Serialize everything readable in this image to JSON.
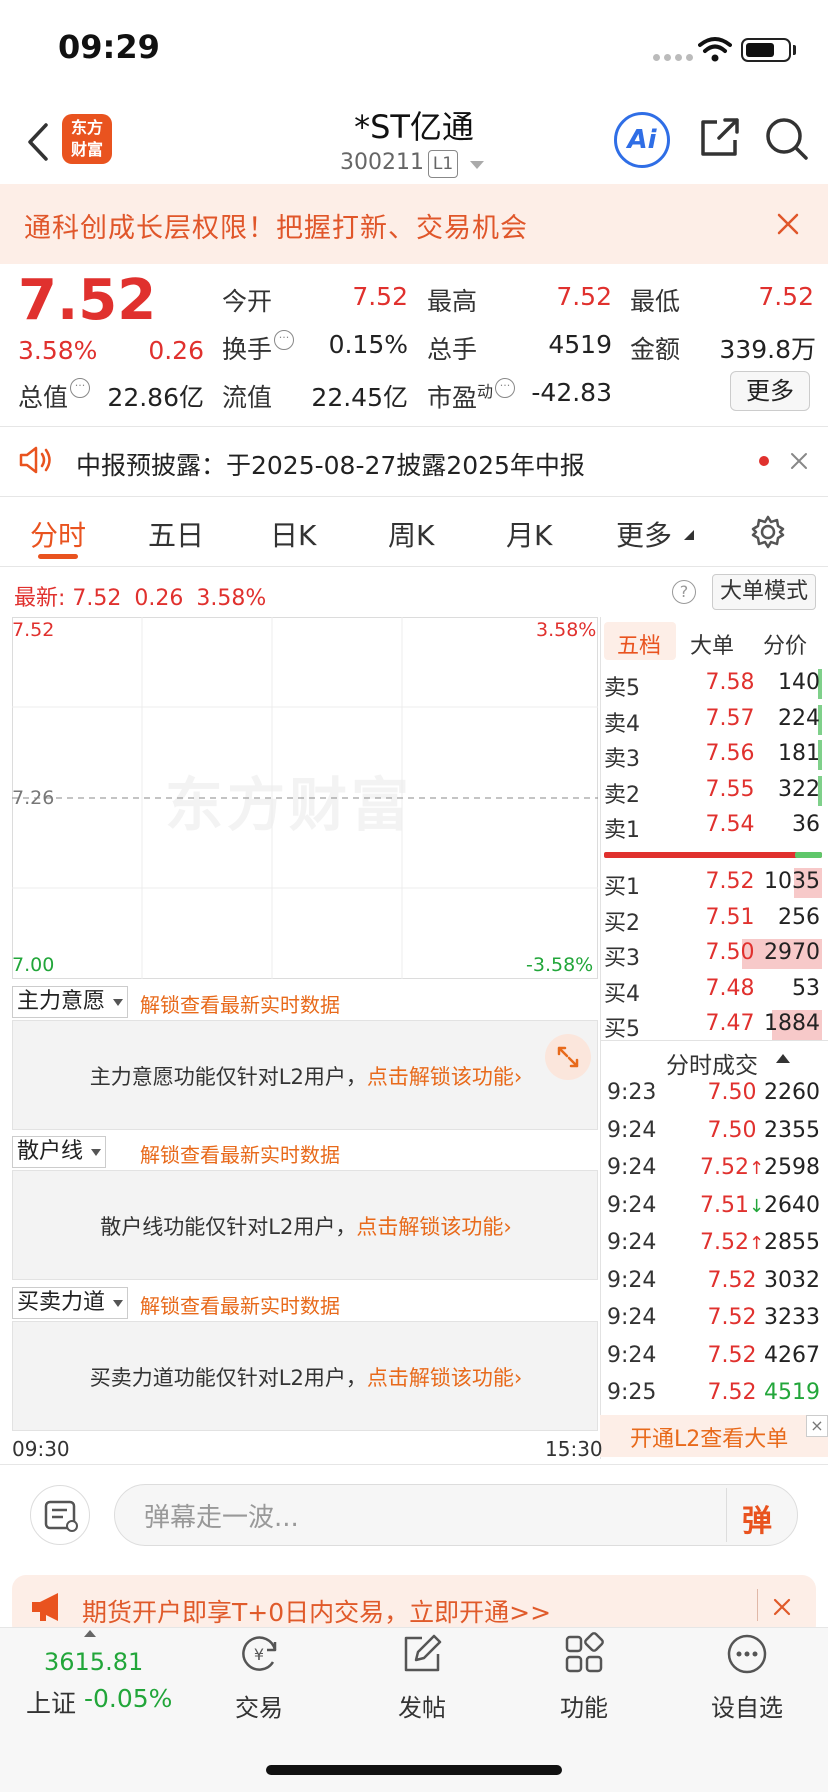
{
  "status_bar": {
    "time": "09:29"
  },
  "header": {
    "logo_line1": "东方",
    "logo_line2": "财富",
    "title": "*ST亿通",
    "code": "300211",
    "level_badge": "L1",
    "ai_label": "Ai"
  },
  "banner": {
    "text": "通科创成长层权限！把握打新、交易机会"
  },
  "quote": {
    "price": "7.52",
    "change_pct": "3.58%",
    "change": "0.26",
    "open_label": "今开",
    "open": "7.52",
    "high_label": "最高",
    "high": "7.52",
    "low_label": "最低",
    "low": "7.52",
    "turnover_label": "换手",
    "turnover": "0.15%",
    "volume_label": "总手",
    "volume": "4519",
    "amount_label": "金额",
    "amount": "339.8万",
    "mktcap_label": "总值",
    "mktcap": "22.86亿",
    "float_label": "流值",
    "float_cap": "22.45亿",
    "pe_label": "市盈",
    "pe_sup": "动",
    "pe": "-42.83",
    "more_button": "更多"
  },
  "notice": {
    "text": "中报预披露：于2025-08-27披露2025年中报"
  },
  "tabs": [
    "分时",
    "五日",
    "日K",
    "周K",
    "月K",
    "更多"
  ],
  "chart": {
    "latest_label": "最新:",
    "latest_price": "7.52",
    "latest_change": "0.26",
    "latest_pct": "3.58%",
    "big_order_mode": "大单模式",
    "help": "?",
    "watermark": "东方财富",
    "y_high": "7.52",
    "y_mid": "7.26",
    "y_low": "7.00",
    "pct_high": "3.58%",
    "pct_low": "-3.58%",
    "time_start": "09:30",
    "time_end": "15:30"
  },
  "chart_data": {
    "type": "line",
    "title": "",
    "xlabel": "",
    "ylabel": "",
    "x_range": [
      "09:30",
      "15:30"
    ],
    "ylim": [
      7.0,
      7.52
    ],
    "reference_price": 7.26,
    "pct_range": [
      "-3.58%",
      "3.58%"
    ],
    "series": []
  },
  "orderbook": {
    "tabs": [
      "五档",
      "大单",
      "分价"
    ],
    "asks": [
      {
        "label": "卖5",
        "price": "7.58",
        "vol": "140",
        "bar_fraction": 0.02
      },
      {
        "label": "卖4",
        "price": "7.57",
        "vol": "224",
        "bar_fraction": 0.02
      },
      {
        "label": "卖3",
        "price": "7.56",
        "vol": "181",
        "bar_fraction": 0.02
      },
      {
        "label": "卖2",
        "price": "7.55",
        "vol": "322",
        "bar_fraction": 0.02
      },
      {
        "label": "卖1",
        "price": "7.54",
        "vol": "36",
        "bar_fraction": 0
      }
    ],
    "bids": [
      {
        "label": "买1",
        "price": "7.52",
        "vol": "1035",
        "bar_fraction": 0.35
      },
      {
        "label": "买2",
        "price": "7.51",
        "vol": "256",
        "bar_fraction": 0
      },
      {
        "label": "买3",
        "price": "7.50",
        "vol": "2970",
        "bar_fraction": 1.0
      },
      {
        "label": "买4",
        "price": "7.48",
        "vol": "53",
        "bar_fraction": 0
      },
      {
        "label": "买5",
        "price": "7.47",
        "vol": "1884",
        "bar_fraction": 0.63
      }
    ]
  },
  "trades": {
    "title": "分时成交",
    "rows": [
      {
        "time": "9:23",
        "price": "7.50",
        "arrow": "",
        "vol": "2260"
      },
      {
        "time": "9:24",
        "price": "7.50",
        "arrow": "",
        "vol": "2355"
      },
      {
        "time": "9:24",
        "price": "7.52",
        "arrow": "↑",
        "vol": "2598"
      },
      {
        "time": "9:24",
        "price": "7.51",
        "arrow": "↓",
        "vol": "2640"
      },
      {
        "time": "9:24",
        "price": "7.52",
        "arrow": "↑",
        "vol": "2855"
      },
      {
        "time": "9:24",
        "price": "7.52",
        "arrow": "",
        "vol": "3032"
      },
      {
        "time": "9:24",
        "price": "7.52",
        "arrow": "",
        "vol": "3233"
      },
      {
        "time": "9:24",
        "price": "7.52",
        "arrow": "",
        "vol": "4267"
      },
      {
        "time": "9:25",
        "price": "7.52",
        "arrow": "",
        "vol": "4519"
      }
    ],
    "l2_banner": "开通L2查看大单"
  },
  "indicators": [
    {
      "name": "主力意愿",
      "unlock_hint": "解锁查看最新实时数据",
      "message": "主力意愿功能仅针对L2用户，",
      "link": "点击解锁该功能"
    },
    {
      "name": "散户线",
      "unlock_hint": "解锁查看最新实时数据",
      "message": "散户线功能仅针对L2用户，",
      "link": "点击解锁该功能"
    },
    {
      "name": "买卖力道",
      "unlock_hint": "解锁查看最新实时数据",
      "message": "买卖力道功能仅针对L2用户，",
      "link": "点击解锁该功能"
    }
  ],
  "comment": {
    "placeholder": "弹幕走一波...",
    "danmu": "弹"
  },
  "ad": {
    "text": "期货开户即享T+0日内交易，立即开通>>"
  },
  "bottom_nav": {
    "index_value": "3615.81",
    "index_label": "上证",
    "index_change": "-0.05%",
    "items": [
      "交易",
      "发帖",
      "功能",
      "设自选"
    ]
  },
  "colors": {
    "up": "#e0312e",
    "down": "#22a63a",
    "accent": "#e9531f",
    "link": "#e86a1b",
    "ai_blue": "#2f6ee6"
  }
}
